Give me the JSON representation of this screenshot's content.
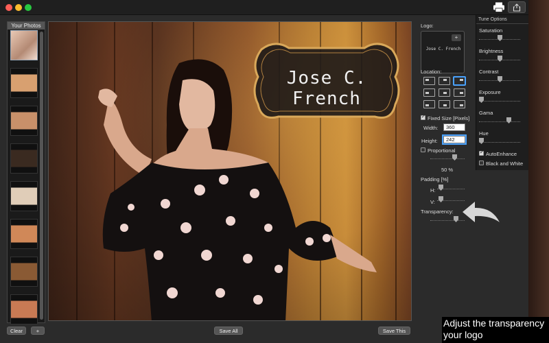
{
  "sidebar": {
    "title": "Your Photos",
    "thumb_count": 8
  },
  "canvas": {
    "logo_text": "Jose C. French"
  },
  "logo_panel": {
    "logo_label": "Logo:",
    "logo_add": "+",
    "logo_preview": "Jose C. French",
    "location_label": "Location:",
    "fixed_size_label": "Fixed Size [Pixels]",
    "width_label": "Width:",
    "width_value": "360",
    "height_label": "Height:",
    "height_value": "242",
    "proportional_label": "Proportional",
    "scale_value": "50 %",
    "scale_fraction": 0.5,
    "padding_label": "Padding [%]",
    "padding_h_label": "H:",
    "padding_v_label": "V:",
    "transparency_label": "Transparency:"
  },
  "tune": {
    "title": "Tune Options",
    "items": [
      {
        "label": "Saturation",
        "level": 0.5
      },
      {
        "label": "Brightness",
        "level": 0.5
      },
      {
        "label": "Contrast",
        "level": 0.5
      },
      {
        "label": "Exposure",
        "level": 0.0
      },
      {
        "label": "Gama",
        "level": 0.75
      },
      {
        "label": "Hue",
        "level": 0.0
      }
    ],
    "auto_enhance_label": "AutoEnhance",
    "black_white_label": "Black and White"
  },
  "bottom": {
    "clear_label": "Clear",
    "add_label": "+",
    "save_all_label": "Save All",
    "save_this_label": "Save This"
  },
  "caption": {
    "line1": "Adjust the transparency",
    "line2": "your logo"
  },
  "colors": {
    "accent": "#4aa3ff",
    "close": "#ff5f57",
    "minimize": "#febc2e",
    "zoom": "#28c840"
  }
}
